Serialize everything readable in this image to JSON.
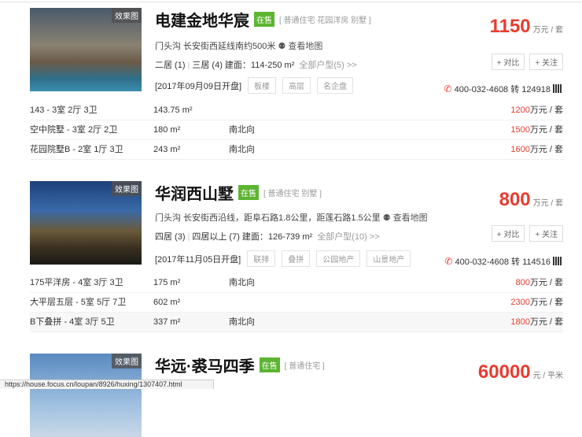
{
  "listings": [
    {
      "badge": "效果图",
      "title": "电建金地华宸",
      "status": "在售",
      "types": "[ 普通住宅 花园洋房 别墅 ]",
      "address": "门头沟 长安街西延线南约500米",
      "map_link": "查看地图",
      "rooms": [
        "二居 (1)",
        "三居 (4)"
      ],
      "area": "建面：114-250 m²",
      "all_types": "全部户型(5) >>",
      "open_date": "[2017年09月09日开盘]",
      "tags": [
        "板楼",
        "高层",
        "名企盘"
      ],
      "price": "1150",
      "price_unit": "万元 / 套",
      "compare": "+ 对比",
      "follow": "+ 关注",
      "phone": "400-032-4608 转 124918",
      "units": [
        {
          "name": "143 - 3室 2厅 3卫",
          "area": "143.75 m²",
          "orient": "",
          "price": "1200",
          "unit": "万元 / 套"
        },
        {
          "name": "空中院墅 - 3室 2厅 2卫",
          "area": "180 m²",
          "orient": "南北向",
          "price": "1500",
          "unit": "万元 / 套"
        },
        {
          "name": "花园院墅B - 2室 1厅 3卫",
          "area": "243 m²",
          "orient": "南北向",
          "price": "1600",
          "unit": "万元 / 套"
        }
      ]
    },
    {
      "badge": "效果图",
      "title": "华润西山墅",
      "status": "在售",
      "types": "[ 普通住宅 别墅 ]",
      "address": "门头沟 长安街西沿线，距阜石路1.8公里，距莲石路1.5公里",
      "map_link": "查看地图",
      "rooms": [
        "四居 (3)",
        "四居以上 (7)"
      ],
      "area": "建面：126-739 m²",
      "all_types": "全部户型(10) >>",
      "open_date": "[2017年11月05日开盘]",
      "tags": [
        "联排",
        "叠拼",
        "公园地产",
        "山景地产"
      ],
      "price": "800",
      "price_unit": "万元 / 套",
      "compare": "+ 对比",
      "follow": "+ 关注",
      "phone": "400-032-4608 转 114516",
      "units": [
        {
          "name": "175平洋房 - 4室 3厅 3卫",
          "area": "175 m²",
          "orient": "南北向",
          "price": "800",
          "unit": "万元 / 套"
        },
        {
          "name": "大平层五层 - 5室 5厅 7卫",
          "area": "602 m²",
          "orient": "",
          "price": "2300",
          "unit": "万元 / 套"
        },
        {
          "name": "B下叠拼 - 4室 3厅 5卫",
          "area": "337 m²",
          "orient": "南北向",
          "price": "1800",
          "unit": "万元 / 套"
        }
      ]
    },
    {
      "badge": "效果图",
      "title": "华远·裘马四季",
      "status": "在售",
      "types": "[ 普通住宅 ]",
      "price": "60000",
      "price_unit": "元 / 平米"
    }
  ],
  "status_bar": "https://house.focus.cn/loupan/8926/huxing/1307407.html"
}
